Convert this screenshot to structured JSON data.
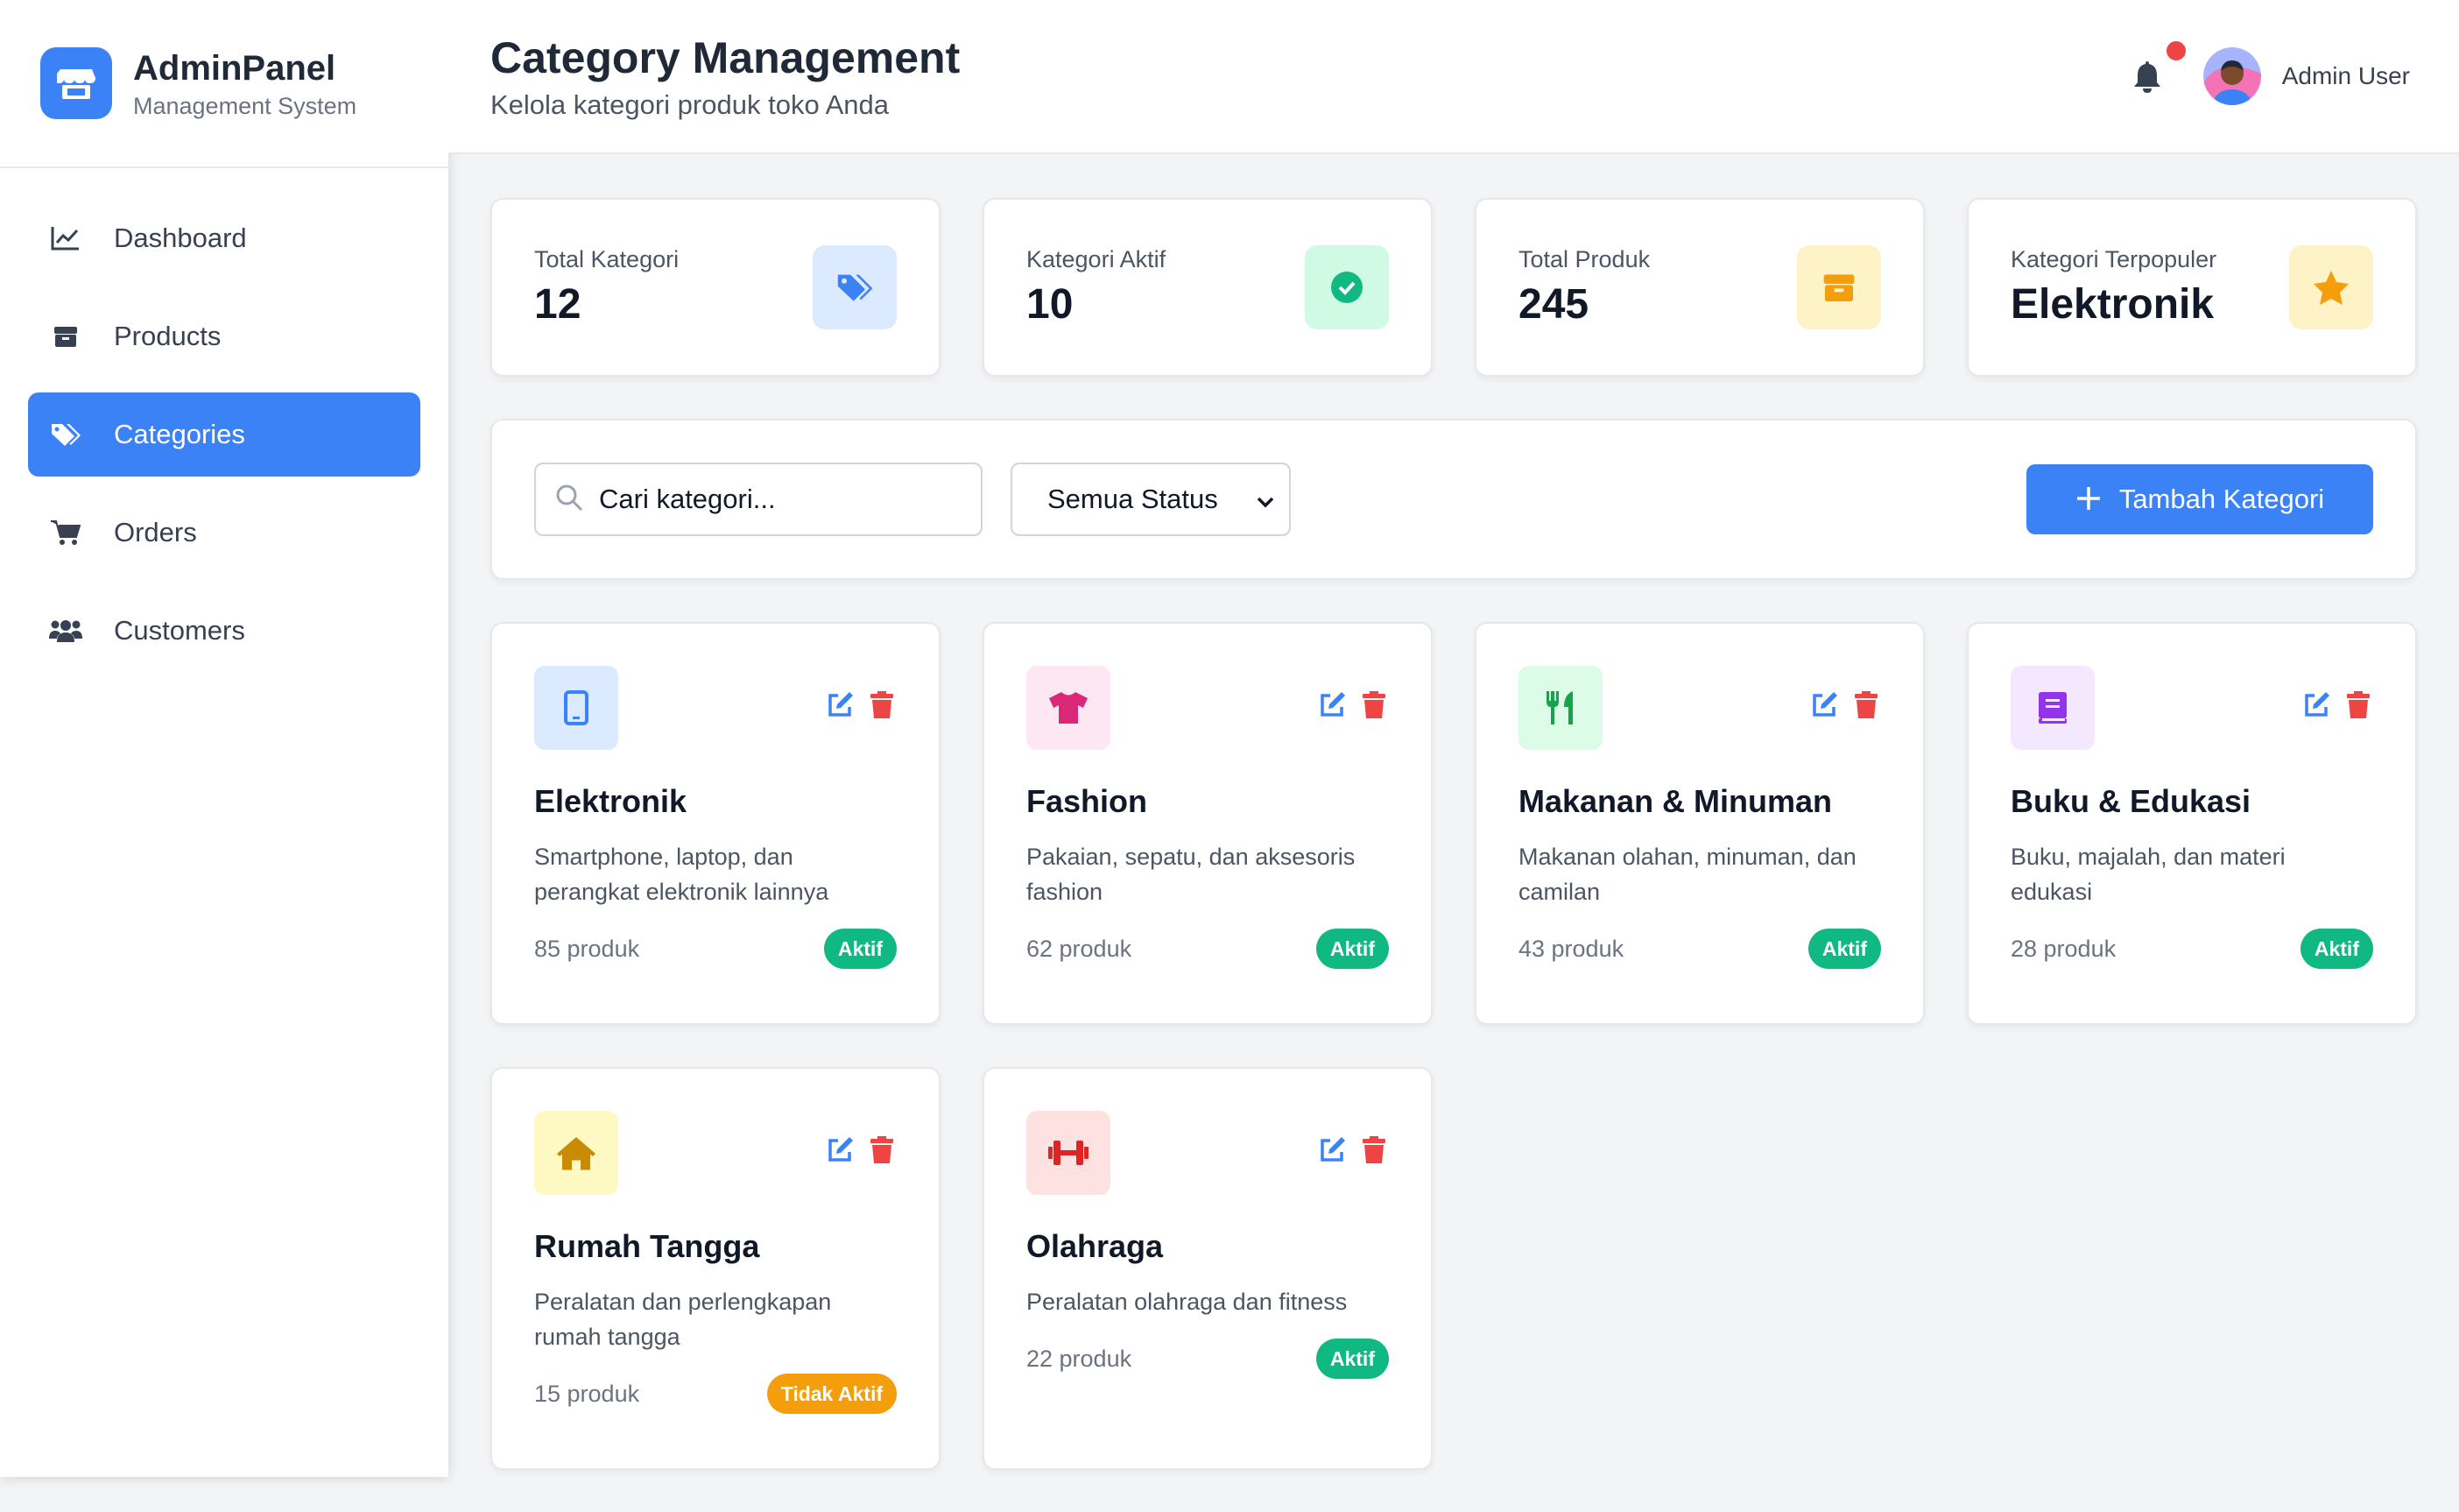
{
  "brand": {
    "title": "AdminPanel",
    "subtitle": "Management System",
    "icon": "store-icon"
  },
  "sidebar": {
    "items": [
      {
        "label": "Dashboard",
        "icon": "chart-line-icon",
        "active": false
      },
      {
        "label": "Products",
        "icon": "box-icon",
        "active": false
      },
      {
        "label": "Categories",
        "icon": "tags-icon",
        "active": true
      },
      {
        "label": "Orders",
        "icon": "shopping-cart-icon",
        "active": false
      },
      {
        "label": "Customers",
        "icon": "users-icon",
        "active": false
      }
    ]
  },
  "header": {
    "title": "Category Management",
    "subtitle": "Kelola kategori produk toko Anda",
    "user_name": "Admin User"
  },
  "stats": [
    {
      "label": "Total Kategori",
      "value": "12",
      "icon": "tags-icon",
      "color": "#3b82f6"
    },
    {
      "label": "Kategori Aktif",
      "value": "10",
      "icon": "check-circle-icon",
      "color": "#10b981"
    },
    {
      "label": "Total Produk",
      "value": "245",
      "icon": "box-icon",
      "color": "#f59e0b"
    },
    {
      "label": "Kategori Terpopuler",
      "value": "Elektronik",
      "icon": "star-icon",
      "color": "#f59e0b"
    }
  ],
  "filter": {
    "search_placeholder": "Cari kategori...",
    "status_selected": "Semua Status",
    "add_label": "Tambah Kategori"
  },
  "categories": [
    {
      "name": "Elektronik",
      "description": "Smartphone, laptop, dan perangkat elektronik lainnya",
      "count": "85 produk",
      "status": "Aktif",
      "icon": "mobile-icon"
    },
    {
      "name": "Fashion",
      "description": "Pakaian, sepatu, dan aksesoris fashion",
      "count": "62 produk",
      "status": "Aktif",
      "icon": "tshirt-icon"
    },
    {
      "name": "Makanan & Minuman",
      "description": "Makanan olahan, minuman, dan camilan",
      "count": "43 produk",
      "status": "Aktif",
      "icon": "utensils-icon"
    },
    {
      "name": "Buku & Edukasi",
      "description": "Buku, majalah, dan materi edukasi",
      "count": "28 produk",
      "status": "Aktif",
      "icon": "book-icon"
    },
    {
      "name": "Rumah Tangga",
      "description": "Peralatan dan perlengkapan rumah tangga",
      "count": "15 produk",
      "status": "Tidak Aktif",
      "icon": "home-icon"
    },
    {
      "name": "Olahraga",
      "description": "Peralatan olahraga dan fitness",
      "count": "22 produk",
      "status": "Aktif",
      "icon": "dumbbell-icon"
    }
  ],
  "colors": {
    "accent": "#3b82f6",
    "active_badge": "#10b981",
    "inactive_badge": "#f59e0b",
    "delete": "#ef4444"
  }
}
